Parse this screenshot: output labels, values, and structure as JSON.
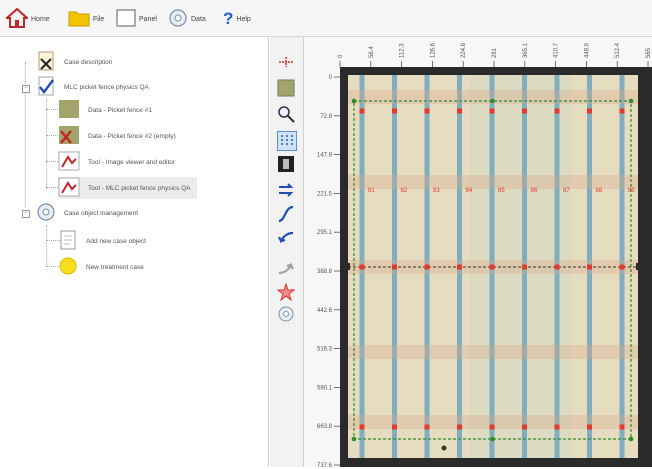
{
  "toolbar": {
    "home_label": "Home",
    "file_label": "File",
    "panel_label": "Panel",
    "data_label": "Data",
    "help_label": "Help"
  },
  "tree": {
    "case_description": "Case description",
    "mlc_qa": "MLC picket fence physics QA",
    "data_1": "Data - Picket fence #1",
    "data_2": "Data - Picket fence #2 (empty)",
    "tool_viewer": "Tool - Image viewer and editor",
    "tool_mlc": "Tool - MLC picket fence physics QA",
    "case_object_mgmt": "Case object management",
    "add_new": "Add new case object",
    "new_treatment": "New treatment case"
  },
  "viewer": {
    "x_ticks": [
      "0",
      "56.4",
      "112.3",
      "126.6",
      "224.6",
      "281",
      "365.1",
      "410.7",
      "448.9",
      "512.4",
      "565"
    ],
    "y_ticks": [
      "0",
      "72.8",
      "147.8",
      "221.5",
      "295.1",
      "368.8",
      "442.6",
      "516.3",
      "590.1",
      "663.8",
      "737.6"
    ],
    "picket_labels": [
      "81",
      "82",
      "83",
      "84",
      "85",
      "86",
      "87",
      "88",
      "89"
    ],
    "colors": {
      "film": "#e6dcc0",
      "picket": "#6fa6be",
      "marker_red": "#e23a2f",
      "marker_green": "#2e8b2e"
    }
  }
}
